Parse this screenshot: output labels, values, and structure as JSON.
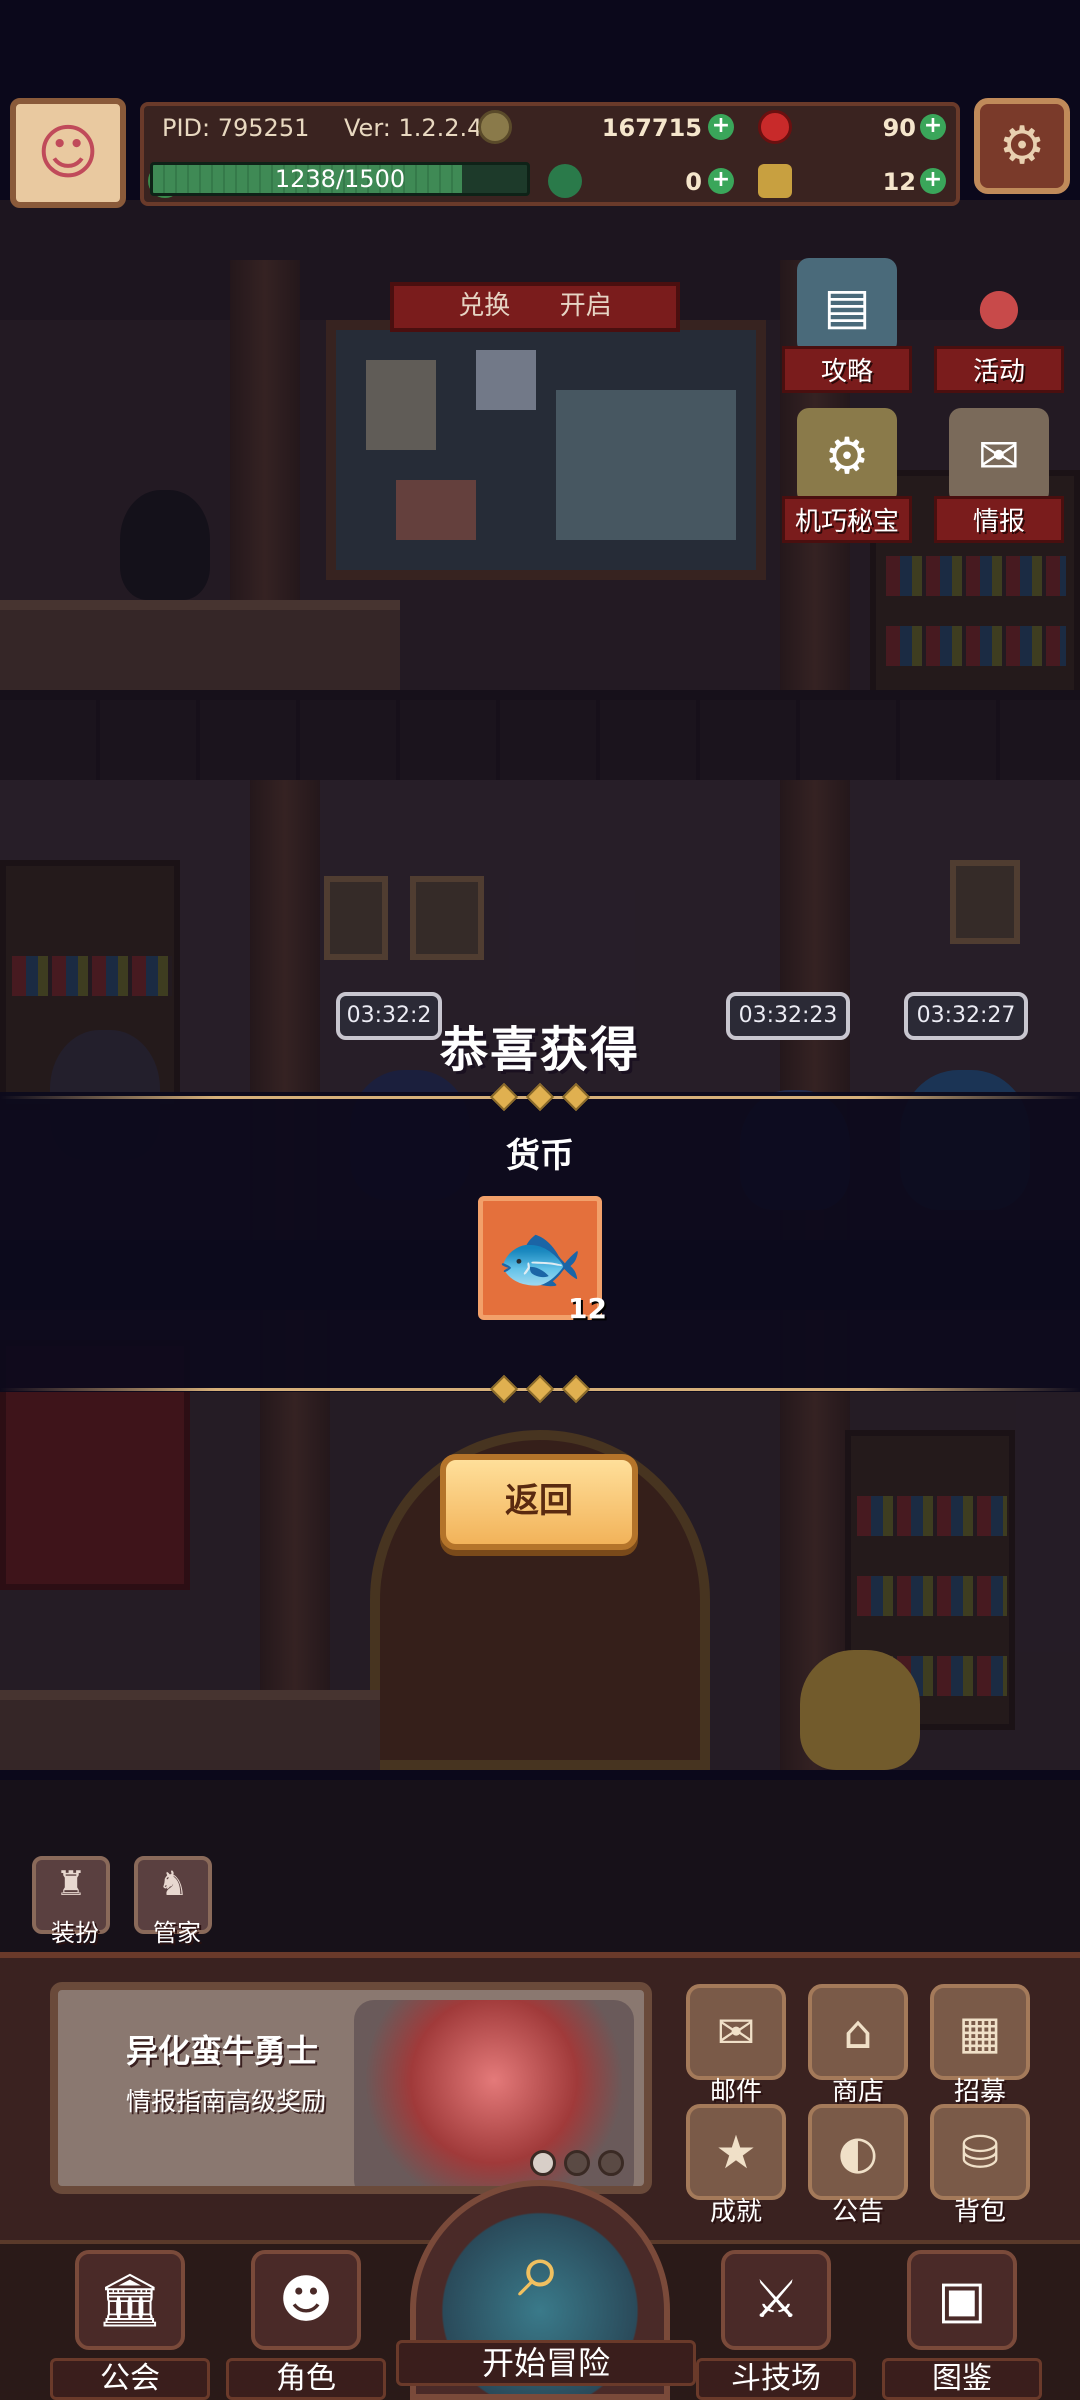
{
  "player": {
    "pid": "PID: 795251",
    "version": "Ver: 1.2.2.4",
    "xp_text": "1238/1500",
    "xp_fraction": 0.825
  },
  "currencies": {
    "coins": "167715",
    "gems": "90",
    "clover": "0",
    "tickets": "12"
  },
  "scene": {
    "exchange_banner": "兑换      开启",
    "side_buttons": [
      {
        "label": "攻略",
        "icon": "chat-icon"
      },
      {
        "label": "活动",
        "icon": "balloon-icon"
      },
      {
        "label": "机巧秘宝",
        "icon": "gear-chest-icon"
      },
      {
        "label": "情报",
        "icon": "intel-icon"
      }
    ],
    "timers": [
      "03:32:2",
      "03:32:23",
      "03:32:27"
    ]
  },
  "reward": {
    "title": "恭喜获得",
    "category": "货币",
    "item_icon": "fish-coin-icon",
    "count": "12",
    "return_label": "返回"
  },
  "quick": {
    "dress_up": "装扮",
    "butler": "管家"
  },
  "promo": {
    "title": "异化蛮牛勇士",
    "subtitle": "情报指南高级奖励"
  },
  "grid_buttons": [
    "邮件",
    "商店",
    "招募",
    "成就",
    "公告",
    "背包"
  ],
  "nav": {
    "guild": "公会",
    "character": "角色",
    "adventure": "开始冒险",
    "arena": "斗技场",
    "codex": "图鉴"
  },
  "colors": {
    "accent_gold": "#d6b07a",
    "reward_bg": "#e4703c",
    "label_red": "#7a1c1c",
    "xp_green": "#3f8a55"
  }
}
